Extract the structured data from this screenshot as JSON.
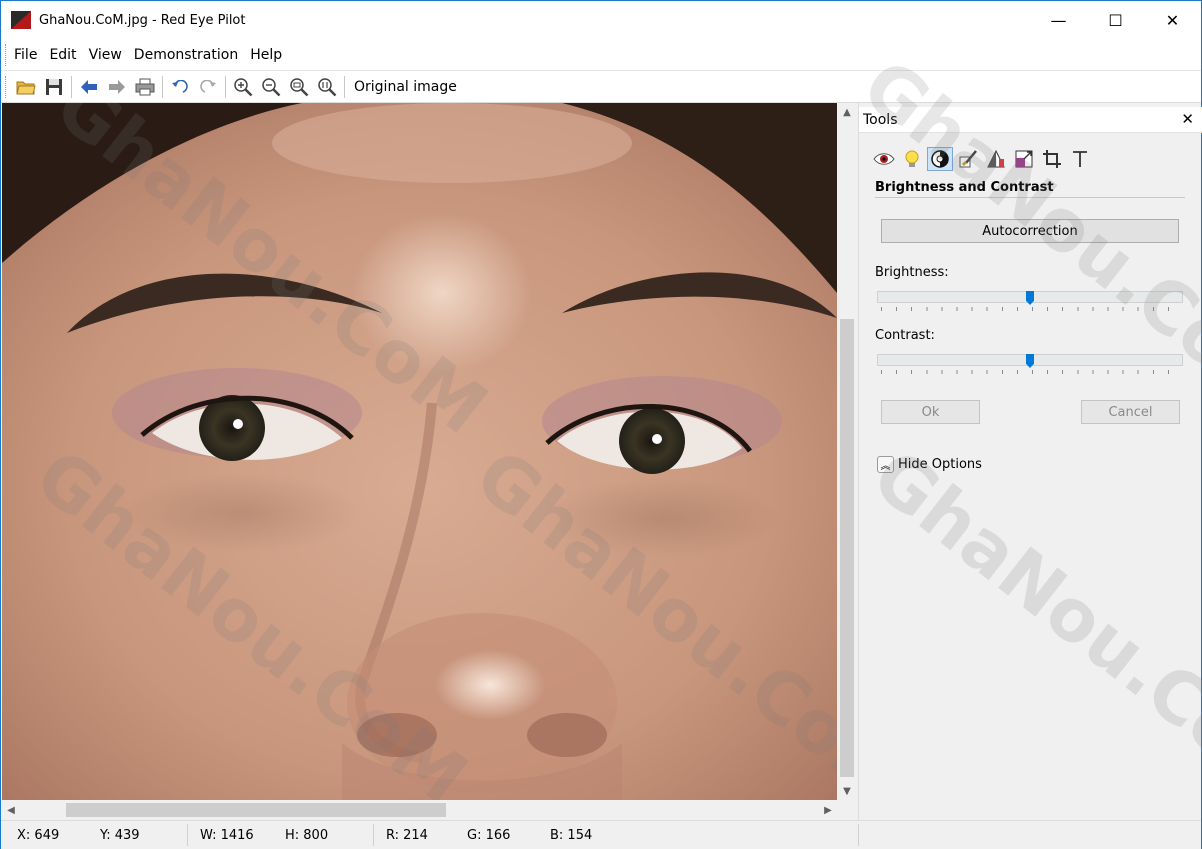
{
  "window": {
    "title": "GhaNou.CoM.jpg - Red Eye Pilot",
    "controls": {
      "minimize": "—",
      "maximize": "☐",
      "close": "✕"
    }
  },
  "menu": [
    "File",
    "Edit",
    "View",
    "Demonstration",
    "Help"
  ],
  "toolbar": {
    "icons": [
      "open-folder-icon",
      "save-icon",
      "back-arrow-icon",
      "forward-arrow-icon",
      "print-icon",
      "undo-icon",
      "redo-icon",
      "zoom-in-icon",
      "zoom-out-icon",
      "zoom-fit-icon",
      "zoom-actual-icon"
    ],
    "original_image_label": "Original image"
  },
  "tools_panel": {
    "title": "Tools",
    "close": "✕",
    "tool_icons": [
      "red-eye-tool-icon",
      "light-bulb-tool-icon",
      "brightness-contrast-tool-icon",
      "retouch-brush-tool-icon",
      "color-tool-icon",
      "resize-tool-icon",
      "crop-tool-icon",
      "text-tool-icon"
    ],
    "active_tool": "brightness-contrast-tool-icon",
    "section_title": "Brightness and Contrast",
    "autocorrection_label": "Autocorrection",
    "brightness_label": "Brightness:",
    "brightness_value": 0.5,
    "contrast_label": "Contrast:",
    "contrast_value": 0.5,
    "ok_label": "Ok",
    "cancel_label": "Cancel",
    "hide_options_label": "Hide Options"
  },
  "status": {
    "x": "X: 649",
    "y": "Y: 439",
    "w": "W: 1416",
    "h": "H: 800",
    "r": "R: 214",
    "g": "G: 166",
    "b": "B: 154"
  },
  "watermark_text": "GhaNou.CoM",
  "colors": {
    "accent": "#0078d7",
    "skin": "#c79a82"
  }
}
